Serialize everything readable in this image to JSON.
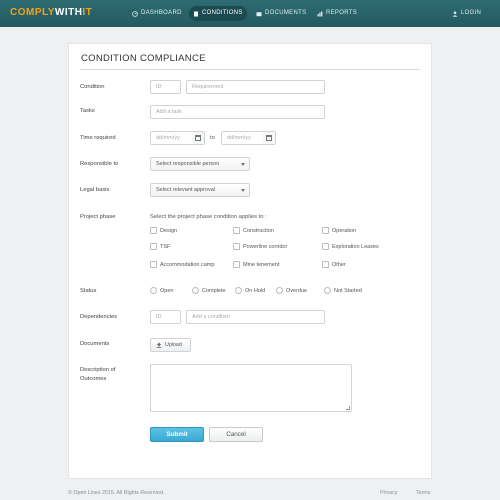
{
  "nav": {
    "logo_part1": "COMPLY",
    "logo_part2": "WITH",
    "logo_part3": "IT",
    "items": [
      {
        "label": "DASHBOARD",
        "icon": "dashboard-icon"
      },
      {
        "label": "CONDITIONS",
        "icon": "document-icon",
        "active": true
      },
      {
        "label": "DOCUMENTS",
        "icon": "folder-icon"
      },
      {
        "label": "REPORTS",
        "icon": "bar-chart-icon"
      }
    ],
    "login": {
      "label": "LOGIN",
      "icon": "user-icon"
    }
  },
  "form": {
    "title": "CONDITION COMPLIANCE",
    "condition": {
      "label": "Condition",
      "id_placeholder": "ID",
      "requirement_placeholder": "Requirement"
    },
    "tasks": {
      "label": "Tasks",
      "placeholder": "Add a task"
    },
    "time_required": {
      "label": "Time required",
      "from_placeholder": "dd/mm/yy",
      "to_label": "to",
      "to_placeholder": "dd/mm/yy"
    },
    "responsible": {
      "label": "Responsible to",
      "value": "Select responsible person"
    },
    "legal_basis": {
      "label": "Legal basis",
      "value": "Select relevant approval"
    },
    "project_phase": {
      "label": "Project phase",
      "hint": "Select the project phase condition applies to :",
      "options": [
        "Design",
        "Construction",
        "Operation",
        "TSF",
        "Powerline corridor",
        "Exploration Leases",
        "Accommodation camp",
        "Mine tenement",
        "Other"
      ]
    },
    "status": {
      "label": "Status",
      "options": [
        "Open",
        "Complete",
        "On Hold",
        "Overdue",
        "Not Started"
      ]
    },
    "dependencies": {
      "label": "Dependencies",
      "id_placeholder": "ID",
      "condition_placeholder": "Add a condition"
    },
    "documents": {
      "label": "Documents",
      "upload_label": "Upload"
    },
    "description": {
      "label_line1": "Description of",
      "label_line2": "Outcomes"
    },
    "submit_label": "Submit",
    "cancel_label": "Cancel"
  },
  "footer": {
    "copyright": "© Open Lines 2015. All Rights Reserved.",
    "privacy": "Privacy",
    "terms": "Terms"
  },
  "colors": {
    "nav_bg": "#2a636a",
    "brand_orange": "#f2a31b",
    "submit_blue": "#45b4dc"
  }
}
